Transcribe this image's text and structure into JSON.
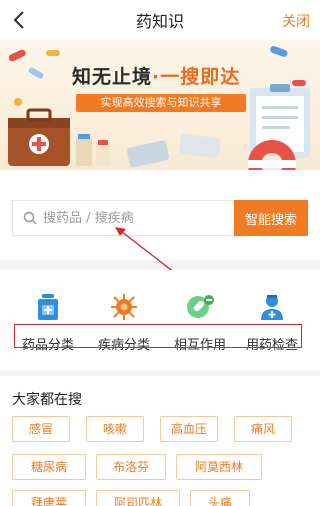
{
  "nav": {
    "title": "药知识",
    "close_label": "关闭"
  },
  "banner": {
    "headline_a": "知无止境",
    "headline_b": "·一搜即达",
    "subtitle": "实现高效搜索与知识共享"
  },
  "search": {
    "placeholder": "搜药品 / 搜疾病",
    "value": "",
    "button_label": "智能搜索"
  },
  "categories": [
    {
      "label": "药品分类",
      "icon": "medicine-bottle-icon"
    },
    {
      "label": "疾病分类",
      "icon": "virus-icon"
    },
    {
      "label": "相互作用",
      "icon": "capsule-icon"
    },
    {
      "label": "用药检查",
      "icon": "doctor-icon"
    }
  ],
  "hot": {
    "title": "大家都在搜",
    "tags": [
      "感冒",
      "咳嗽",
      "高血压",
      "痛风",
      "糖尿病",
      "布洛芬",
      "阿莫西林",
      "拜唐苹",
      "阿司匹林",
      "头痛"
    ]
  },
  "colors": {
    "accent": "#f07b23",
    "annotation_red": "#d9232e"
  }
}
